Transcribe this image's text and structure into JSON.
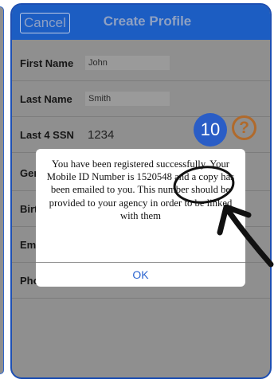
{
  "navbar": {
    "cancel_label": "Cancel",
    "title": "Create Profile"
  },
  "form": {
    "rows": [
      {
        "label": "First Name",
        "value": "John"
      },
      {
        "label": "Last Name",
        "value": "Smith"
      },
      {
        "label": "Last 4 SSN",
        "value": "1234"
      },
      {
        "label": "Ger"
      },
      {
        "label": "Birt"
      },
      {
        "label": "Em"
      },
      {
        "label": "Pho"
      }
    ]
  },
  "step_badge": "10",
  "help": {
    "icon": "question-mark-icon",
    "glyph": "?"
  },
  "dialog": {
    "message": "You have been registered successfully. Your Mobile ID Number is 1520548 and a copy has been emailed to you. This number should be provided to your agency in order to be linked with them",
    "ok_label": "OK"
  },
  "colors": {
    "navbar": "#1c5dc2",
    "background": "#8f8f8f",
    "badge": "#2a5dc6",
    "help_icon": "#b06a2c",
    "annotation": "#111111"
  }
}
